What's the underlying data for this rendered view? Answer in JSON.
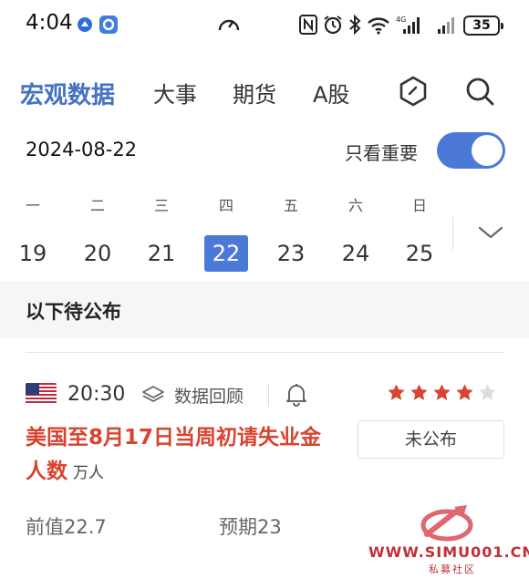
{
  "status_bar": {
    "time": "4:04",
    "battery": "35",
    "icons": [
      "app-icon",
      "browser-icon",
      "speed-icon",
      "nfc-icon",
      "alarm-icon",
      "bluetooth-icon",
      "wifi-icon",
      "signal-4g-icon",
      "signal-icon",
      "battery-icon"
    ]
  },
  "nav": {
    "tabs": [
      {
        "label": "宏观数据",
        "active": true
      },
      {
        "label": "大事"
      },
      {
        "label": "期货"
      },
      {
        "label": "A股"
      }
    ],
    "icons": [
      "hexagon-icon",
      "search-icon"
    ]
  },
  "date_bar": {
    "date": "2024-08-22",
    "toggle_label": "只看重要",
    "toggle_on": true
  },
  "week": {
    "weekdays": [
      "一",
      "二",
      "三",
      "四",
      "五",
      "六",
      "日"
    ],
    "days": [
      "19",
      "20",
      "21",
      "22",
      "23",
      "24",
      "25"
    ],
    "selected_index": 3,
    "expand_icon": "chevron-down-icon"
  },
  "section": {
    "title": "以下待公布"
  },
  "event": {
    "country_flag": "us-flag-icon",
    "time": "20:30",
    "review_label": "数据回顾",
    "bell_icon": "bell-icon",
    "stars_filled": 4,
    "stars_total": 5,
    "title": "美国至8月17日当周初请失业金人数",
    "unit": "万人",
    "status": "未公布",
    "previous": "前值22.7",
    "expected": "预期23",
    "colors": {
      "title": "#d9432f",
      "star": "#d9432f",
      "star_empty": "#dddddd"
    }
  },
  "watermark": {
    "url": "WWW.SIMU001.CN",
    "sub": "私募社区"
  },
  "colors": {
    "accent": "#4c79d8",
    "tab_active": "#4472c4"
  }
}
